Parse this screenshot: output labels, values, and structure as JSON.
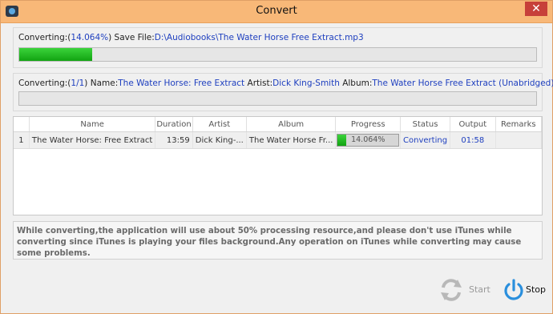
{
  "window": {
    "title": "Convert"
  },
  "file_status": {
    "prefix": "Converting:(",
    "percent": "14.064%",
    "save_label": ") Save File:",
    "path": "D:\\Audiobooks\\The Water Horse Free Extract.mp3",
    "progress_fraction": 0.14064
  },
  "overall_status": {
    "prefix": "Converting:(",
    "count": "1/1",
    "name_label": ") Name:",
    "name": "The Water Horse: Free Extract",
    "artist_label": " Artist:",
    "artist": "Dick King-Smith",
    "album_label": " Album:",
    "album": "The Water Horse Free Extract (Unabridged)",
    "progress_fraction": 0
  },
  "table": {
    "headers": [
      "",
      "Name",
      "Duration",
      "Artist",
      "Album",
      "Progress",
      "Status",
      "Output",
      "Remarks"
    ],
    "rows": [
      {
        "index": "1",
        "name": "The Water Horse: Free Extract",
        "duration": "13:59",
        "artist": "Dick King-...",
        "album": "The Water Horse Fr...",
        "progress": "14.064%",
        "progress_fraction": 0.14064,
        "status": "Converting",
        "output": "01:58",
        "remarks": ""
      }
    ]
  },
  "note": "While converting,the application will use about 50% processing resource,and please don't use iTunes while converting since iTunes is playing your files background.Any operation on iTunes while converting may cause some problems.",
  "buttons": {
    "start": "Start",
    "stop": "Stop"
  },
  "colors": {
    "titlebar": "#f8b878",
    "progress": "#22bb22",
    "link_text": "#1e3fbf"
  },
  "icons": {
    "app": "app-icon",
    "close": "close-icon",
    "start": "refresh-icon",
    "stop": "power-icon"
  }
}
